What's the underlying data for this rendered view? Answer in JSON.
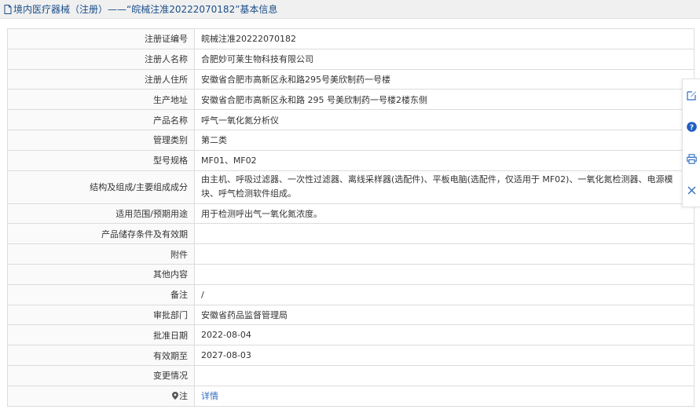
{
  "header": {
    "title": "境内医疗器械（注册）——“皖械注准20222070182”基本信息"
  },
  "rows": [
    {
      "label": "注册证编号",
      "value": "皖械注准20222070182"
    },
    {
      "label": "注册人名称",
      "value": "合肥妙可莱生物科技有限公司"
    },
    {
      "label": "注册人住所",
      "value": "安徽省合肥市高新区永和路295号美欣制药一号楼"
    },
    {
      "label": "生产地址",
      "value": "安徽省合肥市高新区永和路 295 号美欣制药一号楼2楼东侧"
    },
    {
      "label": "产品名称",
      "value": "呼气一氧化氮分析仪"
    },
    {
      "label": "管理类别",
      "value": "第二类"
    },
    {
      "label": "型号规格",
      "value": "MF01、MF02"
    },
    {
      "label": "结构及组成/主要组成成分",
      "value": "由主机、呼吸过滤器、一次性过滤器、离线采样器(选配件)、平板电脑(选配件，仅适用于 MF02)、一氧化氮检测器、电源模块、呼气检测软件组成。"
    },
    {
      "label": "适用范围/预期用途",
      "value": "用于检测呼出气一氧化氮浓度。"
    },
    {
      "label": "产品储存条件及有效期",
      "value": ""
    },
    {
      "label": "附件",
      "value": ""
    },
    {
      "label": "其他内容",
      "value": ""
    },
    {
      "label": "备注",
      "value": "/"
    },
    {
      "label": "审批部门",
      "value": "安徽省药品监督管理局"
    },
    {
      "label": "批准日期",
      "value": "2022-08-04"
    },
    {
      "label": "有效期至",
      "value": "2027-08-03"
    },
    {
      "label": "变更情况",
      "value": ""
    }
  ],
  "note_row": {
    "label": "注",
    "link": "详情"
  },
  "sidebar": {
    "tools": [
      {
        "icon": "edit-icon",
        "color": "#2d6cc0"
      },
      {
        "icon": "help-icon",
        "color": "#1f5fc2"
      },
      {
        "icon": "print-icon",
        "color": "#2d6cc0"
      },
      {
        "icon": "close-icon",
        "color": "#2d6cc0"
      }
    ]
  }
}
